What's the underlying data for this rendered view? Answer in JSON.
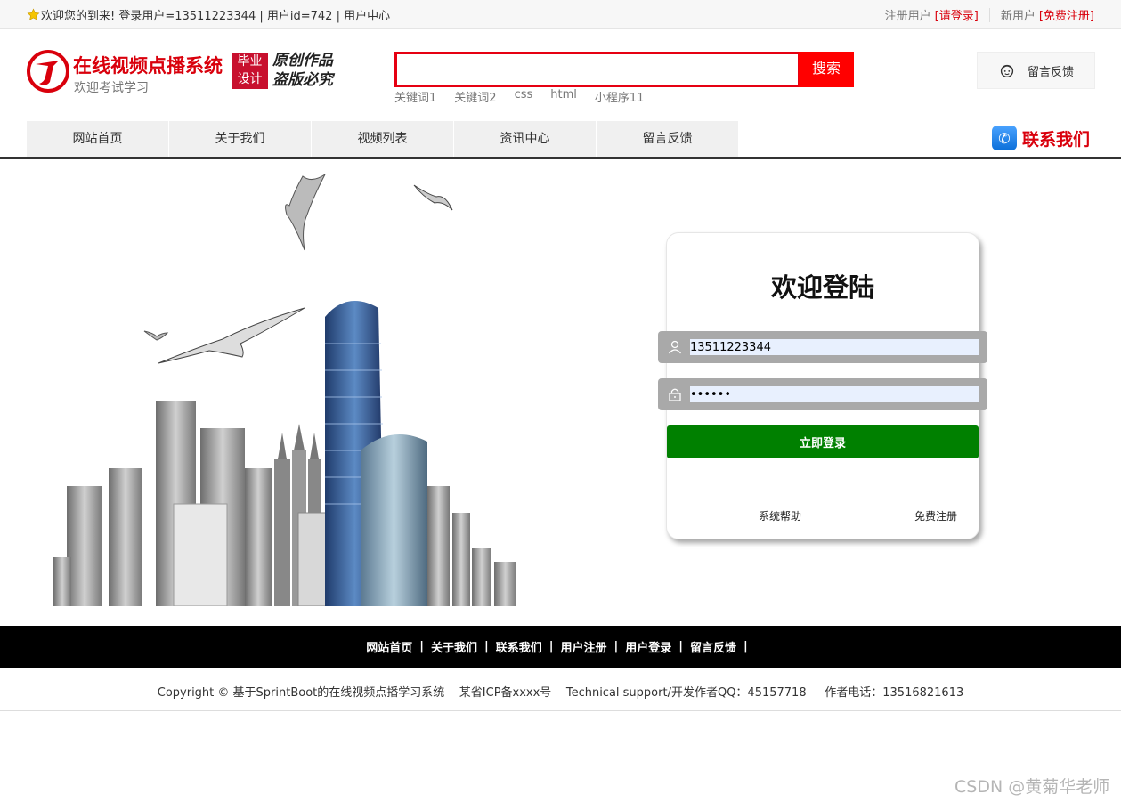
{
  "topbar": {
    "welcome": "欢迎您的到来!  登录用户=13511223344 | 用户id=742 | 用户中心",
    "register_prefix": "注册用户",
    "register_link": "[请登录]",
    "new_user_prefix": "新用户",
    "new_user_link": "[免费注册]"
  },
  "brand": {
    "title": "在线视频点播系统",
    "subtitle": "欢迎考试学习",
    "badge_line1": "毕业",
    "badge_line2": "设计",
    "motto_line1": "原创作品",
    "motto_line2": "盗版必究",
    "color": "#d9000c"
  },
  "search": {
    "value": "",
    "button": "搜索",
    "keywords": [
      "关键词1",
      "关键词2",
      "css",
      "html",
      "小程序11"
    ]
  },
  "feedback_button": "留言反馈",
  "nav": {
    "items": [
      "网站首页",
      "关于我们",
      "视频列表",
      "资讯中心",
      "留言反馈"
    ]
  },
  "contact": "联系我们",
  "login": {
    "title": "欢迎登陆",
    "username": "13511223344",
    "password": "••••••",
    "submit": "立即登录",
    "help": "系统帮助",
    "register": "免费注册",
    "submit_color": "#008000"
  },
  "footer": {
    "links": [
      "网站首页",
      "关于我们",
      "联系我们",
      "用户注册",
      "用户登录",
      "留言反馈"
    ],
    "copyright": "Copyright © 基于SprintBoot的在线视频点播学习系统    某省ICP备xxxx号    Technical support/开发作者QQ：45157718     作者电话：13516821613"
  },
  "watermark": "CSDN @黄菊华老师"
}
